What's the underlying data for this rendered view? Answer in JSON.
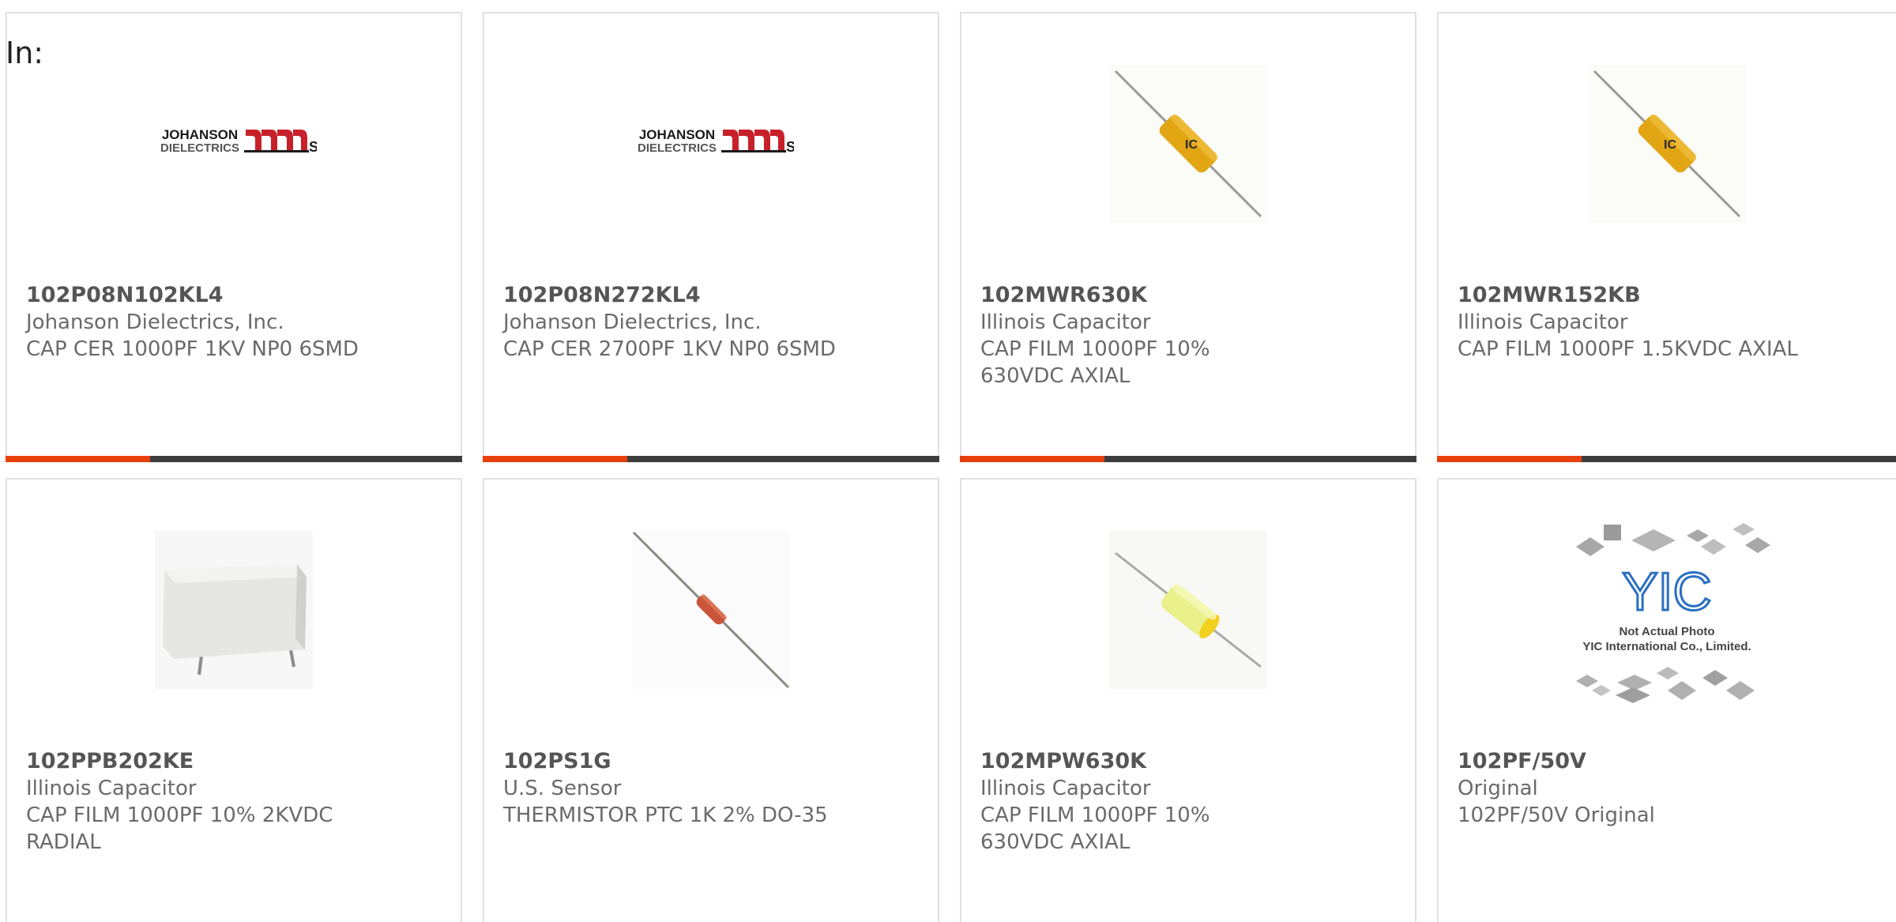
{
  "header": {
    "in_label": "In:"
  },
  "products": [
    {
      "part_number": "102P08N102KL4",
      "manufacturer": "Johanson Dielectrics, Inc.",
      "description": "CAP CER 1000PF 1KV NP0 6SMD",
      "image": "johanson-logo",
      "logo_line1": "JOHANSON",
      "logo_line2": "DIELECTRICS"
    },
    {
      "part_number": "102P08N272KL4",
      "manufacturer": "Johanson Dielectrics, Inc.",
      "description": "CAP CER 2700PF 1KV NP0 6SMD",
      "image": "johanson-logo",
      "logo_line1": "JOHANSON",
      "logo_line2": "DIELECTRICS"
    },
    {
      "part_number": "102MWR630K",
      "manufacturer": "Illinois Capacitor",
      "description": "CAP FILM 1000PF 10% 630VDC AXIAL",
      "image": "axial-film-capacitor-yellow"
    },
    {
      "part_number": "102MWR152KB",
      "manufacturer": "Illinois Capacitor",
      "description": "CAP FILM 1000PF 1.5KVDC AXIAL",
      "image": "axial-film-capacitor-yellow"
    },
    {
      "part_number": "102PPB202KE",
      "manufacturer": "Illinois Capacitor",
      "description": "CAP FILM 1000PF 10% 2KVDC RADIAL",
      "image": "radial-box-capacitor"
    },
    {
      "part_number": "102PS1G",
      "manufacturer": "U.S. Sensor",
      "description": "THERMISTOR PTC 1K 2% DO-35",
      "image": "do35-thermistor"
    },
    {
      "part_number": "102MPW630K",
      "manufacturer": "Illinois Capacitor",
      "description": "CAP FILM 1000PF 10% 630VDC AXIAL",
      "image": "axial-film-capacitor-light-yellow"
    },
    {
      "part_number": "102PF/50V",
      "manufacturer": "Original",
      "description": "102PF/50V Original",
      "image": "yic-placeholder",
      "placeholder_logo": "YIC",
      "placeholder_line1": "Not Actual Photo",
      "placeholder_line2": "YIC International Co., Limited."
    }
  ],
  "colors": {
    "accent": "#e8400c",
    "bar": "#3d3d3d",
    "border": "#e1e1e1",
    "text": "#6a6a6a"
  }
}
